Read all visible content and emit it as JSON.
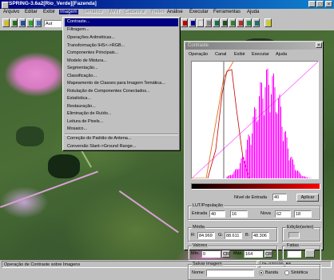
{
  "app": {
    "title": "SPRING-3.6a2[Rio_Verde][Fazenda]"
  },
  "window_buttons": {
    "minimize": "_",
    "maximize": "□",
    "close": "×"
  },
  "menubar": [
    {
      "label": "Arquivo",
      "state": "normal"
    },
    {
      "label": "Editar",
      "state": "normal"
    },
    {
      "label": "Exibir",
      "state": "normal"
    },
    {
      "label": "Imagem",
      "state": "active"
    },
    {
      "label": "Temático",
      "state": "disabled"
    },
    {
      "label": "MNT",
      "state": "disabled"
    },
    {
      "label": "Cadastral",
      "state": "disabled"
    },
    {
      "label": "Redes",
      "state": "disabled"
    },
    {
      "label": "Análise",
      "state": "normal"
    },
    {
      "label": "Executar",
      "state": "normal"
    },
    {
      "label": "Ferramentas",
      "state": "normal"
    },
    {
      "label": "Ajuda",
      "state": "normal"
    }
  ],
  "toolbar": {
    "combo_value": "Aut"
  },
  "image_menu": {
    "items": [
      "Contraste...",
      "Filtragem...",
      "Operações Aritméticas...",
      "Transformação IHS<->RGB...",
      "Componentes Principais...",
      "Modelo de Mistura...",
      "Segmentação...",
      "Classificação...",
      "Mapeamento de Classes para Imagem Temática...",
      "Rotulação de Componentes Conectados...",
      "Estatística...",
      "Restauração...",
      "Eliminação de Ruído...",
      "Leitura de Pixels...",
      "Mosaico...",
      "Correção do Padrão de Antena...",
      "Conversão Slant->Ground Range..."
    ],
    "selected_index": 0
  },
  "contrast_dialog": {
    "title": "Contraste",
    "close": "×",
    "menu": [
      "Operação",
      "Canal",
      "Exibir",
      "Executar",
      "Ajuda"
    ],
    "nivel_label": "Nível de Entrada",
    "nivel_value": "40",
    "aplicar": "Aplicar",
    "lut": {
      "title": "LUT/População",
      "entrada_label": "Entrada",
      "entrada_value": "40",
      "entrada_value2": "16",
      "nova_label": "Nova",
      "nova_value": "62",
      "nova_value2": "18"
    },
    "media": {
      "title": "Média",
      "r_label": "R:",
      "r_value": "84.969",
      "g_label": "G:",
      "g_value": "88.611",
      "b_label": "B:",
      "b_value": "48.306"
    },
    "edicao": {
      "title": "Edição(aviso)"
    },
    "valores": {
      "title": "Valores",
      "min_label": "Mín.",
      "min_value": "0",
      "max_label": "Máx.",
      "max_value": "164",
      "cr": "CR"
    },
    "fatias": {
      "title": "Fatias"
    },
    "salvar": {
      "title": "Salvar imagem",
      "nome_label": "Nome:",
      "banda_label": "Banda",
      "sintetica_label": "Sintética",
      "selected": "Banda"
    }
  },
  "colors": {
    "title_bar": "#000080",
    "selection": "#000080",
    "histogram_pink": "#ff00ff",
    "histogram_orange": "#e07020",
    "histogram_red": "#c00000",
    "lut_bar": "#ff0000"
  },
  "statusbar": {
    "message": "Operação de Contraste sobre Imagens",
    "coords": "Pt: 070100_B5"
  }
}
